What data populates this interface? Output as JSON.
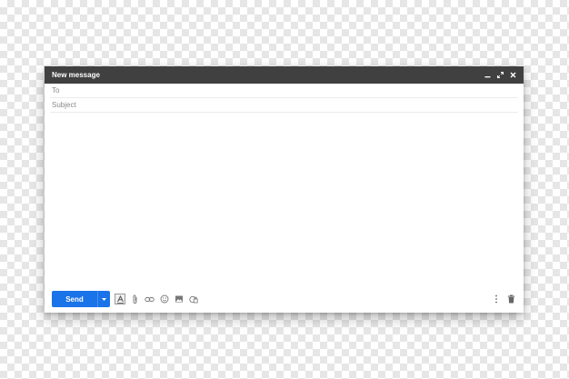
{
  "window": {
    "title": "New message"
  },
  "controls": [
    {
      "name": "minimize-icon"
    },
    {
      "name": "expand-icon"
    },
    {
      "name": "close-icon"
    }
  ],
  "fields": {
    "to_placeholder": "To",
    "subject_placeholder": "Subject",
    "to_value": "",
    "subject_value": "",
    "body_value": ""
  },
  "toolbar": {
    "send_label": "Send",
    "tools": [
      "text-format-icon",
      "attach-file-icon",
      "insert-link-icon",
      "insert-emoji-icon",
      "insert-photo-icon",
      "confidential-mode-icon"
    ],
    "right_tools": [
      "more-options-icon",
      "discard-draft-icon"
    ]
  },
  "colors": {
    "titlebar": "#404040",
    "send_button": "#1a73e8",
    "icon": "#777777"
  }
}
